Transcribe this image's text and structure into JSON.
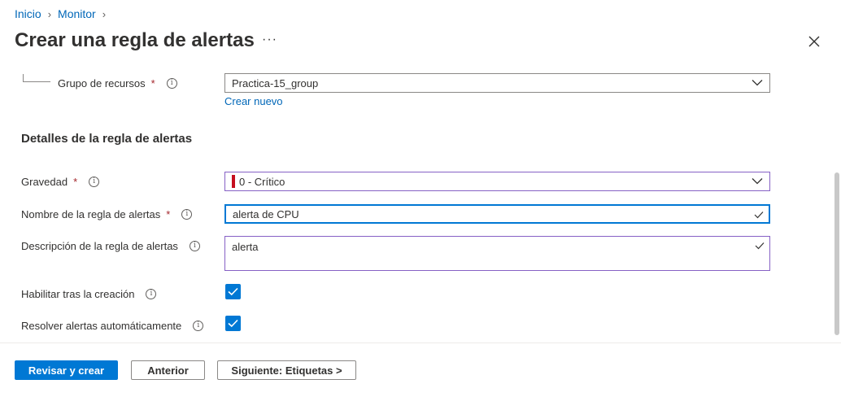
{
  "breadcrumb": {
    "items": [
      "Inicio",
      "Monitor"
    ]
  },
  "header": {
    "title": "Crear una regla de alertas",
    "more": "···"
  },
  "form": {
    "resource_group": {
      "label": "Grupo de recursos",
      "required": "*",
      "value": "Practica-15_group",
      "create_new": "Crear nuevo"
    },
    "section_title": "Detalles de la regla de alertas",
    "severity": {
      "label": "Gravedad",
      "required": "*",
      "value": "0 - Crítico",
      "indicator_color": "#c50f1f"
    },
    "rule_name": {
      "label": "Nombre de la regla de alertas",
      "required": "*",
      "value": "alerta de CPU"
    },
    "description": {
      "label": "Descripción de la regla de alertas",
      "value": "alerta"
    },
    "enable_on_create": {
      "label": "Habilitar tras la creación",
      "checked": true
    },
    "auto_resolve": {
      "label": "Resolver alertas automáticamente",
      "checked": true
    }
  },
  "footer": {
    "review_create": "Revisar y crear",
    "previous": "Anterior",
    "next": "Siguiente: Etiquetas >"
  },
  "colors": {
    "accent": "#0078d4",
    "link": "#0067b8",
    "focus_border": "#8661c5",
    "required": "#a4262c"
  }
}
